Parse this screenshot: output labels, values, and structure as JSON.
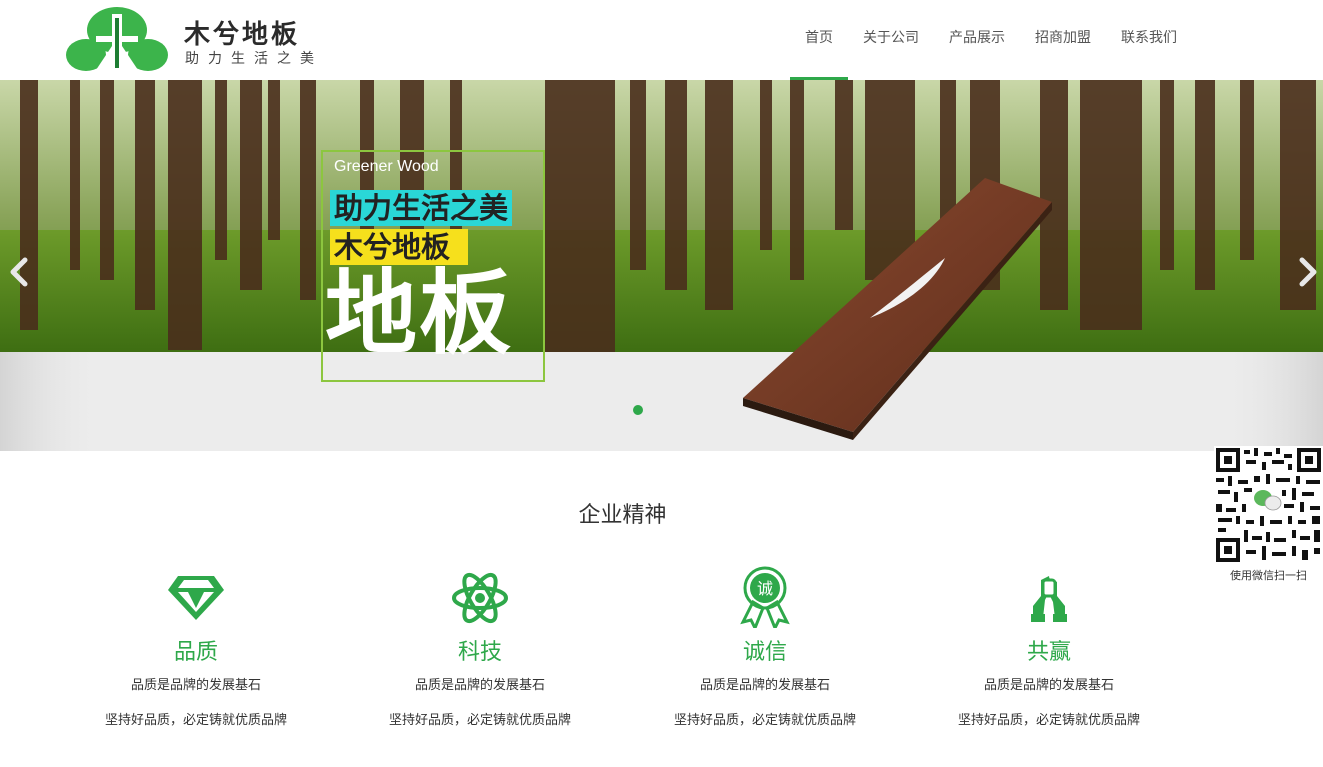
{
  "header": {
    "brand_title": "木兮地板",
    "brand_tagline": "助力生活之美",
    "nav": [
      {
        "label": "首页",
        "active": true
      },
      {
        "label": "关于公司",
        "active": false
      },
      {
        "label": "产品展示",
        "active": false
      },
      {
        "label": "招商加盟",
        "active": false
      },
      {
        "label": "联系我们",
        "active": false
      }
    ]
  },
  "banner": {
    "eyebrow": "Greener Wood",
    "tagline": "助力生活之美",
    "brand": "木兮地板",
    "big_word": "地板",
    "slide_count": 1,
    "active_slide": 1
  },
  "section": {
    "title": "企业精神",
    "features": [
      {
        "icon": "diamond-icon",
        "title": "品质",
        "line1": "品质是品牌的发展基石",
        "line2": "坚持好品质，必定铸就优质品牌"
      },
      {
        "icon": "atom-icon",
        "title": "科技",
        "line1": "品质是品牌的发展基石",
        "line2": "坚持好品质，必定铸就优质品牌"
      },
      {
        "icon": "award-badge-icon",
        "title": "诚信",
        "line1": "品质是品牌的发展基石",
        "line2": "坚持好品质，必定铸就优质品牌",
        "badge_text": "诚"
      },
      {
        "icon": "handshake-icon",
        "title": "共赢",
        "line1": "品质是品牌的发展基石",
        "line2": "坚持好品质，必定铸就优质品牌"
      }
    ]
  },
  "qr": {
    "caption": "使用微信扫一扫"
  },
  "colors": {
    "accent": "#2ea84a",
    "cyan_tag": "#2ad7d7",
    "yellow_tag": "#f6e01c",
    "frame": "#8cc63f"
  }
}
